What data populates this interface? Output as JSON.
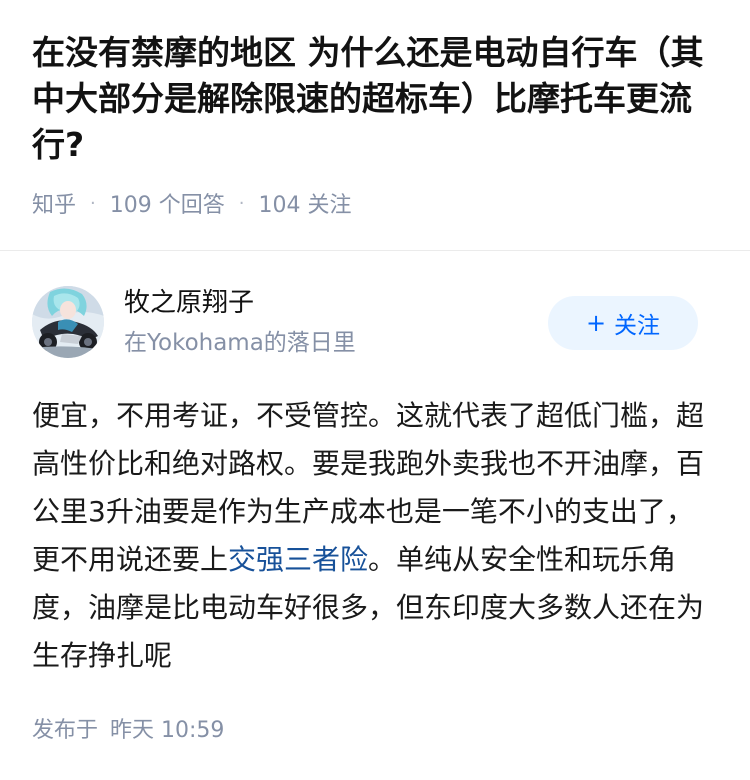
{
  "question": {
    "title": "在没有禁摩的地区 为什么还是电动自行车（其中大部分是解除限速的超标车）比摩托车更流行?",
    "source": "知乎",
    "answers_count": "109 个回答",
    "followers_count": "104 关注"
  },
  "answer": {
    "author": {
      "name": "牧之原翔子",
      "bio": "在Yokohama的落日里"
    },
    "follow_button": {
      "icon": "+",
      "label": "关注"
    },
    "content": {
      "part1": "便宜，不用考证，不受管控。这就代表了超低门槛，超高性价比和绝对路权。要是我跑外卖我也不开油摩，百公里3升油要是作为生产成本也是一笔不小的支出了，更不用说还要上",
      "link": "交强三者险",
      "part2": "。单纯从安全性和玩乐角度，油摩是比电动车好很多，但东印度大多数人还在为生存挣扎呢"
    },
    "published_label": "发布于",
    "published_time": "昨天 10:59"
  },
  "colors": {
    "link_blue": "#175199",
    "follow_text": "#0066ff",
    "follow_bg": "#ebf5ff",
    "meta_gray": "#8590a6"
  }
}
